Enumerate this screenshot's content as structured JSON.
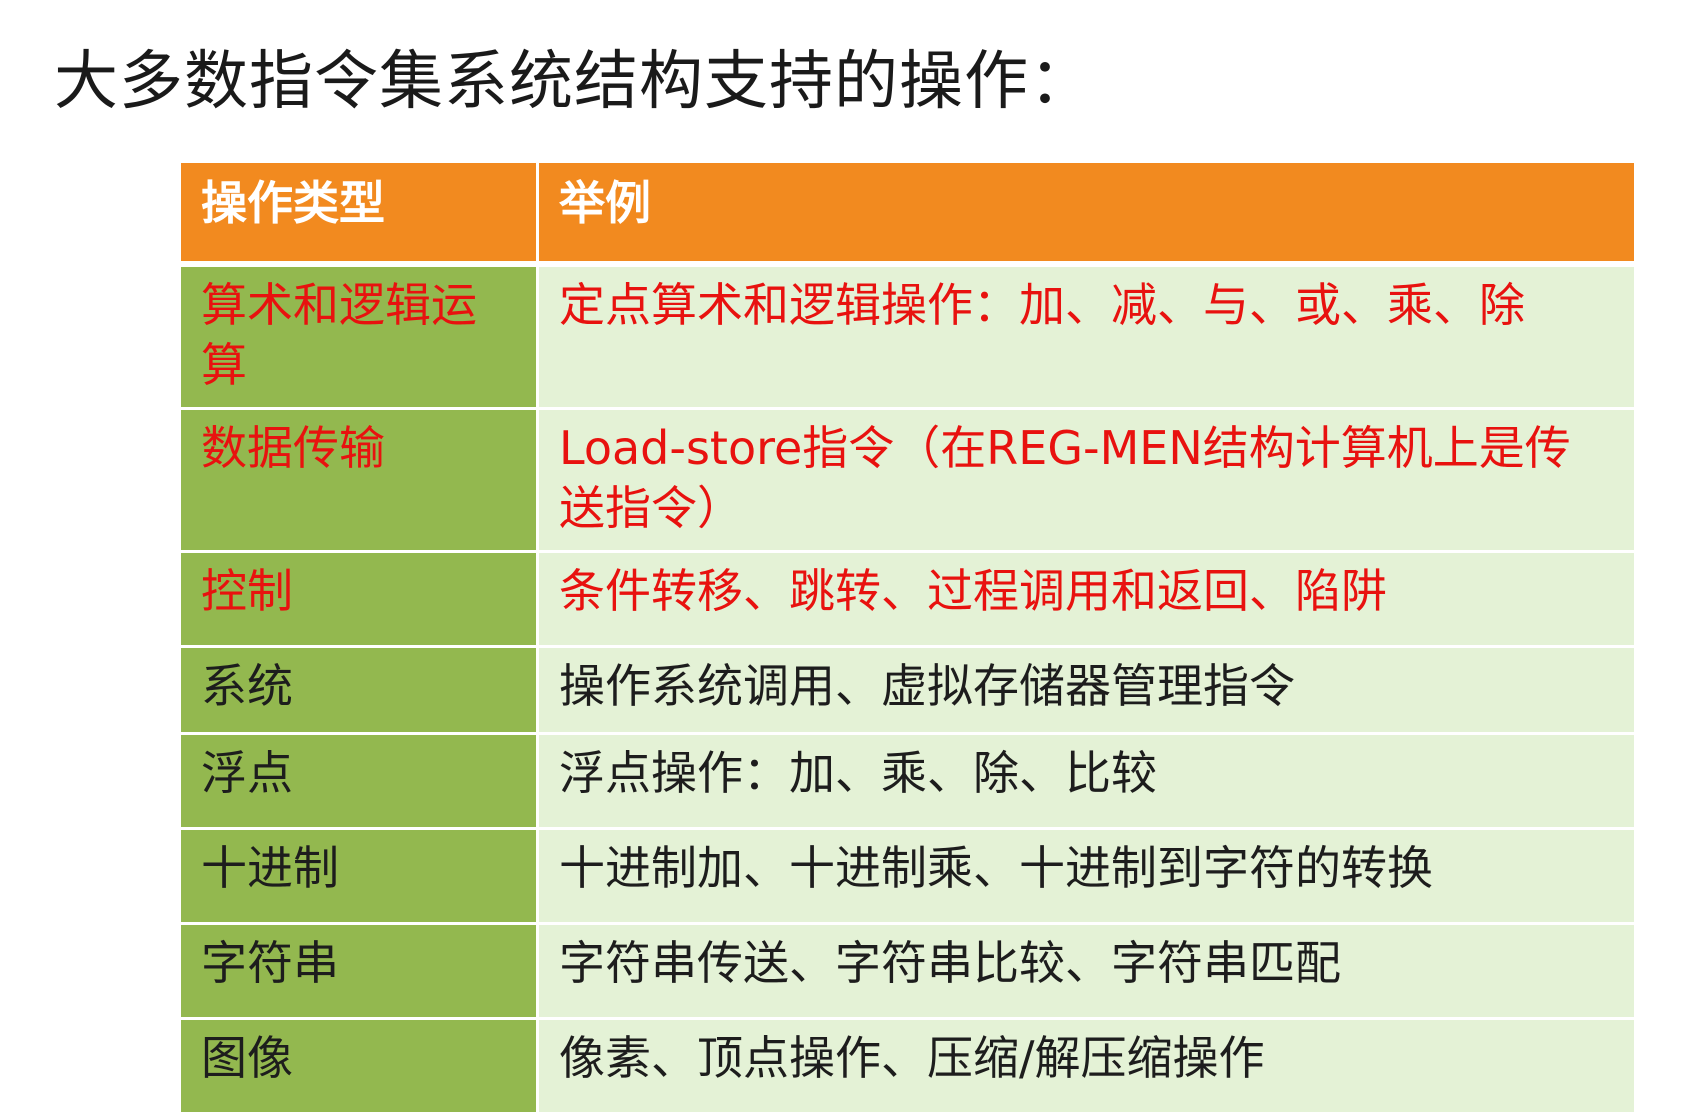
{
  "slide": {
    "title": "大多数指令集系统结构支持的操作："
  },
  "table": {
    "headers": [
      "操作类型",
      "举例"
    ],
    "colors": {
      "header_bg": "#f28a1f",
      "type_col_bg": "#93b84f",
      "example_col_bg": "#e4f2d6",
      "highlight_text": "#e8120f",
      "normal_text": "#1d1d1d"
    },
    "rows": [
      {
        "type": "算术和逻辑运算",
        "example": "定点算术和逻辑操作：加、减、与、或、乘、除",
        "highlighted": true
      },
      {
        "type": "数据传输",
        "example": "Load-store指令（在REG-MEN结构计算机上是传送指令）",
        "highlighted": true
      },
      {
        "type": "控制",
        "example": "条件转移、跳转、过程调用和返回、陷阱",
        "highlighted": true
      },
      {
        "type": "系统",
        "example": "操作系统调用、虚拟存储器管理指令",
        "highlighted": false
      },
      {
        "type": "浮点",
        "example": "浮点操作：加、乘、除、比较",
        "highlighted": false
      },
      {
        "type": "十进制",
        "example": "十进制加、十进制乘、十进制到字符的转换",
        "highlighted": false
      },
      {
        "type": "字符串",
        "example": "字符串传送、字符串比较、字符串匹配",
        "highlighted": false
      },
      {
        "type": "图像",
        "example": "像素、顶点操作、压缩/解压缩操作",
        "highlighted": false
      }
    ]
  }
}
